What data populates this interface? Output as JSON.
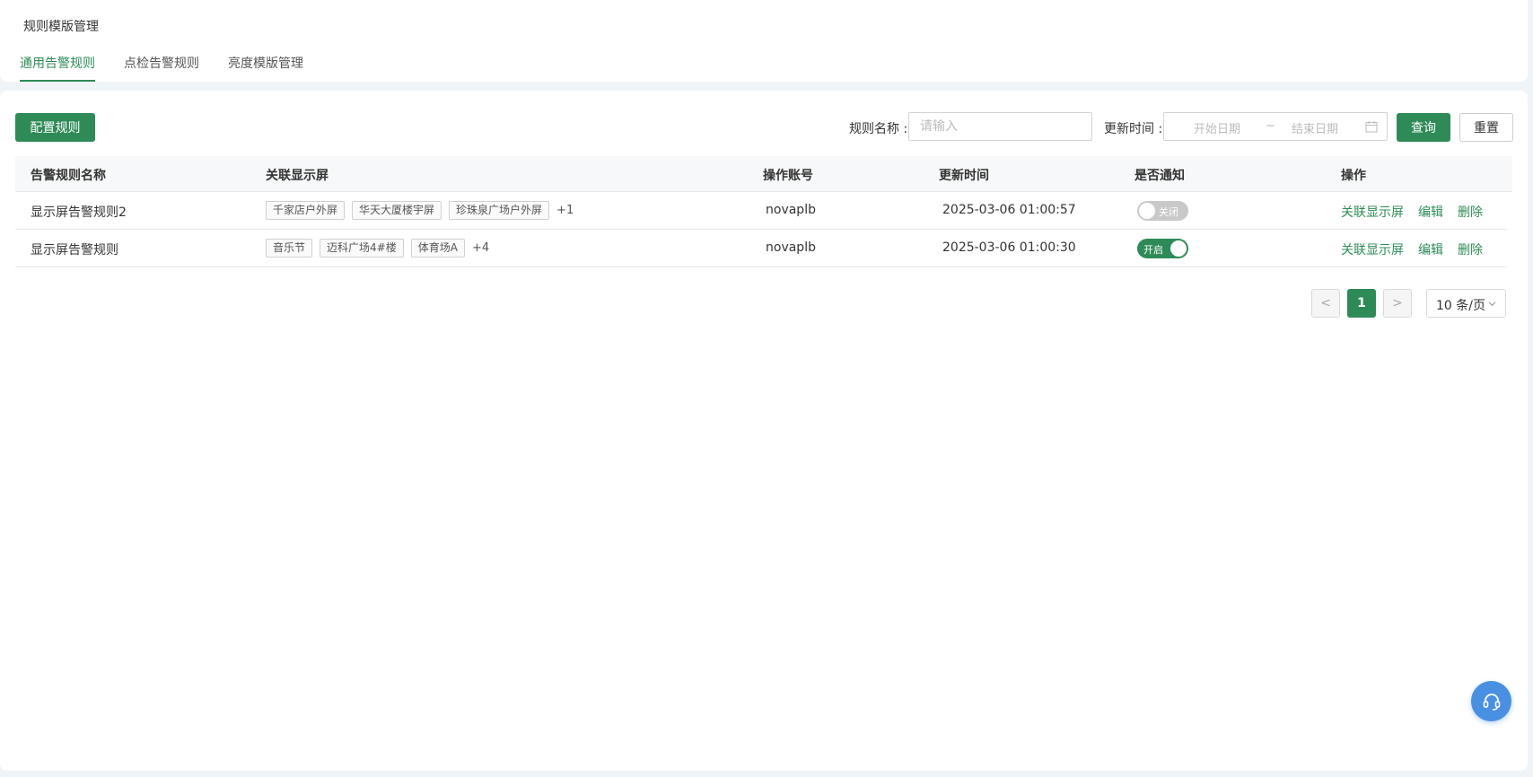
{
  "page_title": "规则模版管理",
  "tabs": [
    {
      "label": "通用告警规则",
      "active": true
    },
    {
      "label": "点检告警规则",
      "active": false
    },
    {
      "label": "亮度模版管理",
      "active": false
    }
  ],
  "toolbar": {
    "config_label": "配置规则",
    "name_label": "规则名称 :",
    "name_placeholder": "请输入",
    "time_label": "更新时间 :",
    "start_placeholder": "开始日期",
    "range_sep": "~",
    "end_placeholder": "结束日期",
    "query_label": "查询",
    "reset_label": "重置"
  },
  "table": {
    "headers": [
      "告警规则名称",
      "关联显示屏",
      "操作账号",
      "更新时间",
      "是否通知",
      "操作"
    ],
    "rows": [
      {
        "name": "显示屏告警规则2",
        "screens": [
          "千家店户外屏",
          "华天大厦楼宇屏",
          "珍珠泉广场户外屏"
        ],
        "more": "+1",
        "account": "novaplb",
        "updated": "2025-03-06 01:00:57",
        "notify_on": false,
        "notify_text": "关闭",
        "actions": [
          "关联显示屏",
          "编辑",
          "删除"
        ]
      },
      {
        "name": "显示屏告警规则",
        "screens": [
          "音乐节",
          "迈科广场4#楼",
          "体育场A"
        ],
        "more": "+4",
        "account": "novaplb",
        "updated": "2025-03-06 01:00:30",
        "notify_on": true,
        "notify_text": "开启",
        "actions": [
          "关联显示屏",
          "编辑",
          "删除"
        ]
      }
    ]
  },
  "pagination": {
    "prev": "<",
    "current": "1",
    "next": ">",
    "page_size": "10 条/页"
  },
  "colors": {
    "accent": "#2e8b57",
    "support": "#4a90e2"
  },
  "icons": {
    "calendar": "calendar-icon",
    "chevron": "chevron-down-icon",
    "support": "headset-icon"
  }
}
